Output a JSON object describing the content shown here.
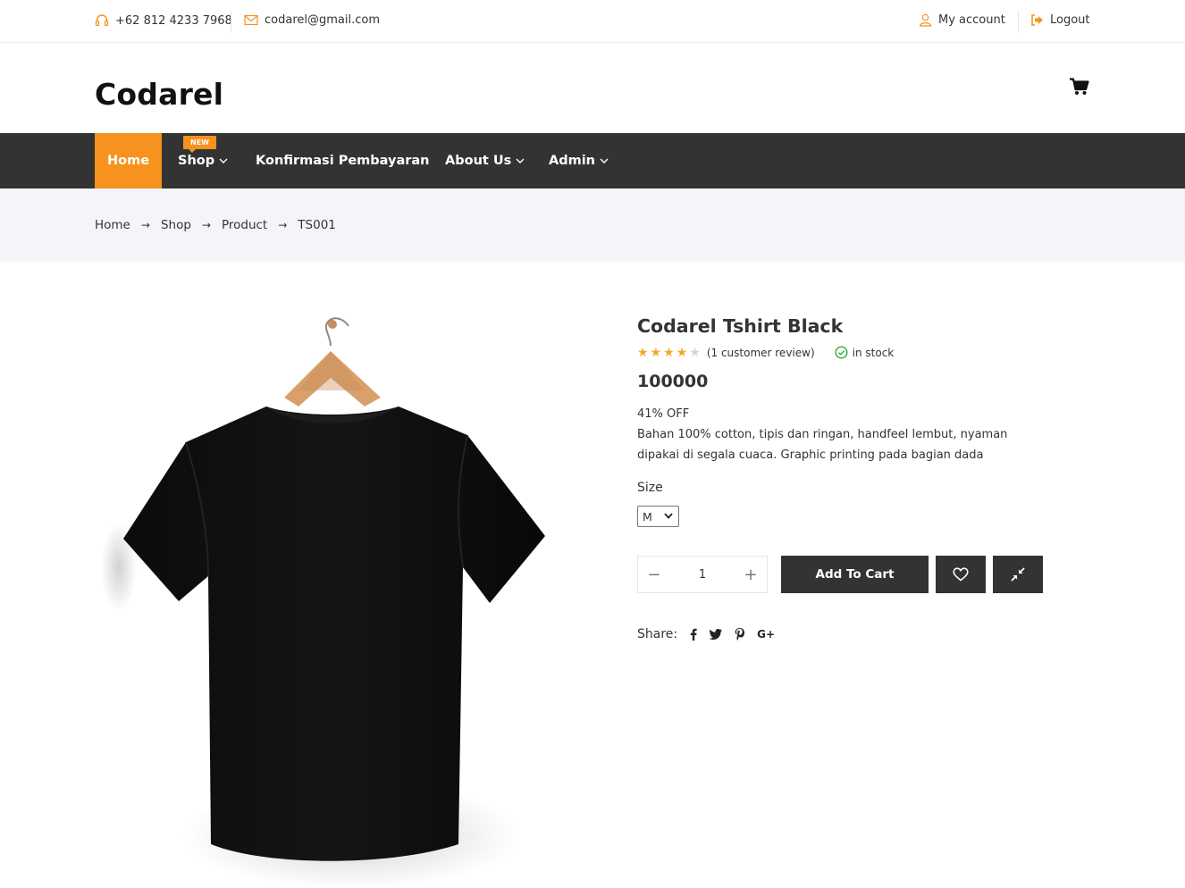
{
  "topbar": {
    "phone": "+62 812 4233 7968",
    "email": "codarel@gmail.com",
    "my_account": "My account",
    "logout": "Logout",
    "accent": "#f6921e"
  },
  "header": {
    "logo": "Codarel"
  },
  "nav": {
    "items": [
      {
        "label": "Home"
      },
      {
        "label": "Shop"
      },
      {
        "label": "Konfirmasi Pembayaran"
      },
      {
        "label": "About Us"
      },
      {
        "label": "Admin"
      }
    ],
    "new_badge": "NEW",
    "background": "#333333",
    "active_color": "#f6921e"
  },
  "breadcrumb": {
    "items": [
      "Home",
      "Shop",
      "Product",
      "TS001"
    ],
    "separator": "→"
  },
  "product": {
    "title": "Codarel Tshirt Black",
    "rating": 4,
    "rating_max": 5,
    "reviews": "(1 customer review)",
    "stock": "in stock",
    "price": "100000",
    "discount": "41% OFF",
    "description": "Bahan 100% cotton, tipis dan ringan, handfeel lembut, nyaman dipakai di segala cuaca. Graphic printing pada bagian dada",
    "size_label": "Size",
    "size_value": "M",
    "quantity": "1",
    "qty_minus": "−",
    "qty_plus": "+",
    "add_to_cart": "Add To Cart",
    "share_label": "Share:",
    "share_google": "G+",
    "star_color": "#f6a623"
  }
}
